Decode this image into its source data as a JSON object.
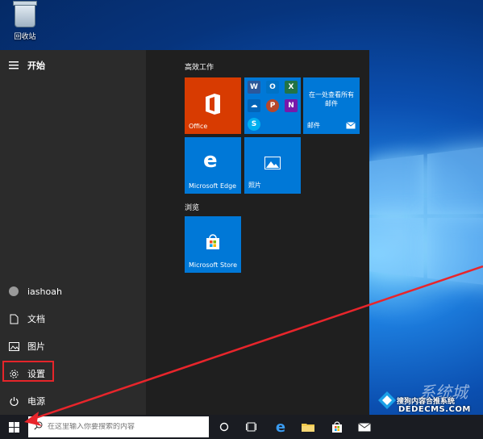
{
  "desktop": {
    "recycle_bin_label": "回收站"
  },
  "start_menu": {
    "header": "开始",
    "user": "iashoah",
    "rail_items": {
      "documents": "文档",
      "pictures": "图片",
      "settings": "设置",
      "power": "电源"
    },
    "groups": {
      "productivity": "高效工作",
      "explore": "浏览"
    },
    "tiles": {
      "office": "Office",
      "mail_text": "在一处查看所有邮件",
      "mail": "邮件",
      "edge": "Microsoft Edge",
      "photos": "照片",
      "store": "Microsoft Store"
    }
  },
  "taskbar": {
    "search_placeholder": "在这里输入你要搜索的内容"
  },
  "watermark": {
    "line1": "搜狗内容合推系统",
    "line2": "DEDECMS.COM",
    "big": "系统城"
  },
  "colors": {
    "accent": "#0078d7",
    "office": "#d83b01",
    "highlight": "#e5252a"
  }
}
